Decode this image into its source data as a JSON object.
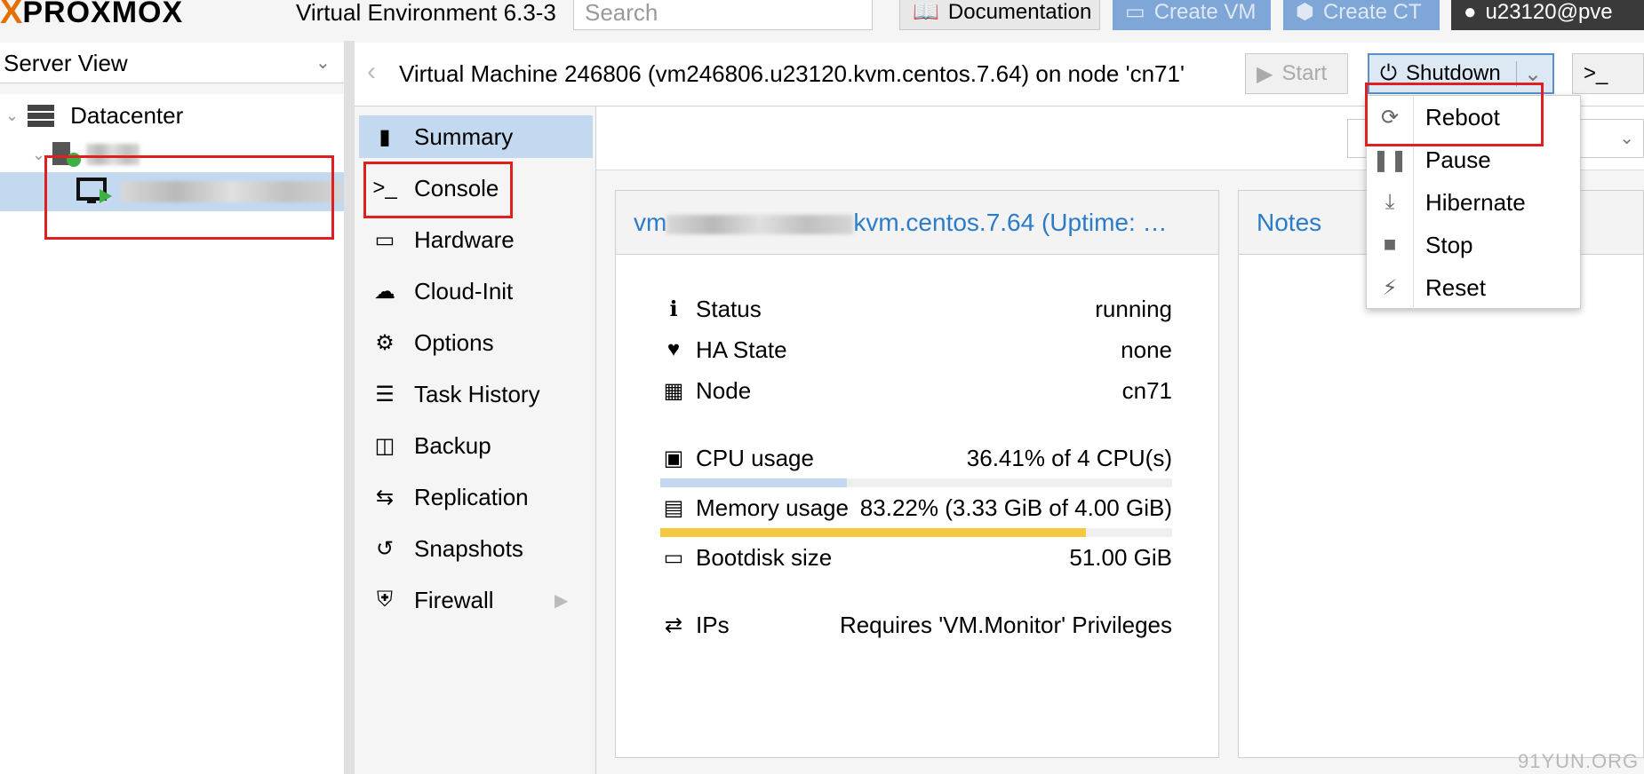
{
  "app": {
    "logo_text": "PROXMOX",
    "version": "Virtual Environment 6.3-3",
    "search_placeholder": "Search",
    "buttons": {
      "documentation": "Documentation",
      "create_vm": "Create VM",
      "create_ct": "Create CT",
      "user": "u23120@pve"
    }
  },
  "tree": {
    "view_label": "Server View",
    "datacenter": "Datacenter"
  },
  "vm_header": {
    "title": "Virtual Machine 246806 (vm246806.u23120.kvm.centos.7.64) on node 'cn71'",
    "start": "Start",
    "shutdown": "Shutdown",
    "console": ">_"
  },
  "nav": {
    "items": [
      {
        "label": "Summary",
        "icon": "book-icon"
      },
      {
        "label": "Console",
        "icon": "terminal-icon"
      },
      {
        "label": "Hardware",
        "icon": "monitor-icon"
      },
      {
        "label": "Cloud-Init",
        "icon": "cloud-icon"
      },
      {
        "label": "Options",
        "icon": "gear-icon"
      },
      {
        "label": "Task History",
        "icon": "list-icon"
      },
      {
        "label": "Backup",
        "icon": "floppy-icon"
      },
      {
        "label": "Replication",
        "icon": "retweet-icon"
      },
      {
        "label": "Snapshots",
        "icon": "history-icon"
      },
      {
        "label": "Firewall",
        "icon": "shield-icon"
      }
    ]
  },
  "summary": {
    "panel_title_visible": "kvm.centos.7.64 (Uptime: …",
    "panel_title_prefix": "vm",
    "notes_title": "Notes",
    "status_label": "Status",
    "status_value": "running",
    "ha_label": "HA State",
    "ha_value": "none",
    "node_label": "Node",
    "node_value": "cn71",
    "cpu_label": "CPU usage",
    "cpu_value": "36.41% of 4 CPU(s)",
    "cpu_fraction": 0.3641,
    "mem_label": "Memory usage",
    "mem_value": "83.22% (3.33 GiB of 4.00 GiB)",
    "mem_fraction": 0.8322,
    "disk_label": "Bootdisk size",
    "disk_value": "51.00 GiB",
    "ips_label": "IPs",
    "ips_value": "Requires 'VM.Monitor' Privileges"
  },
  "shutdown_menu": {
    "items": [
      {
        "label": "Reboot",
        "icon": "refresh-icon"
      },
      {
        "label": "Pause",
        "icon": "pause-icon"
      },
      {
        "label": "Hibernate",
        "icon": "download-icon"
      },
      {
        "label": "Stop",
        "icon": "stop-icon"
      },
      {
        "label": "Reset",
        "icon": "bolt-icon"
      }
    ]
  },
  "colors": {
    "accent_blue": "#2a7bc8",
    "selected_bg": "#c3d9f0",
    "cpu_bar": "#c3d9f0",
    "mem_bar": "#f5c842",
    "logo_orange": "#e57000",
    "highlight_red": "#e02020"
  },
  "watermark": "91YUN.ORG"
}
